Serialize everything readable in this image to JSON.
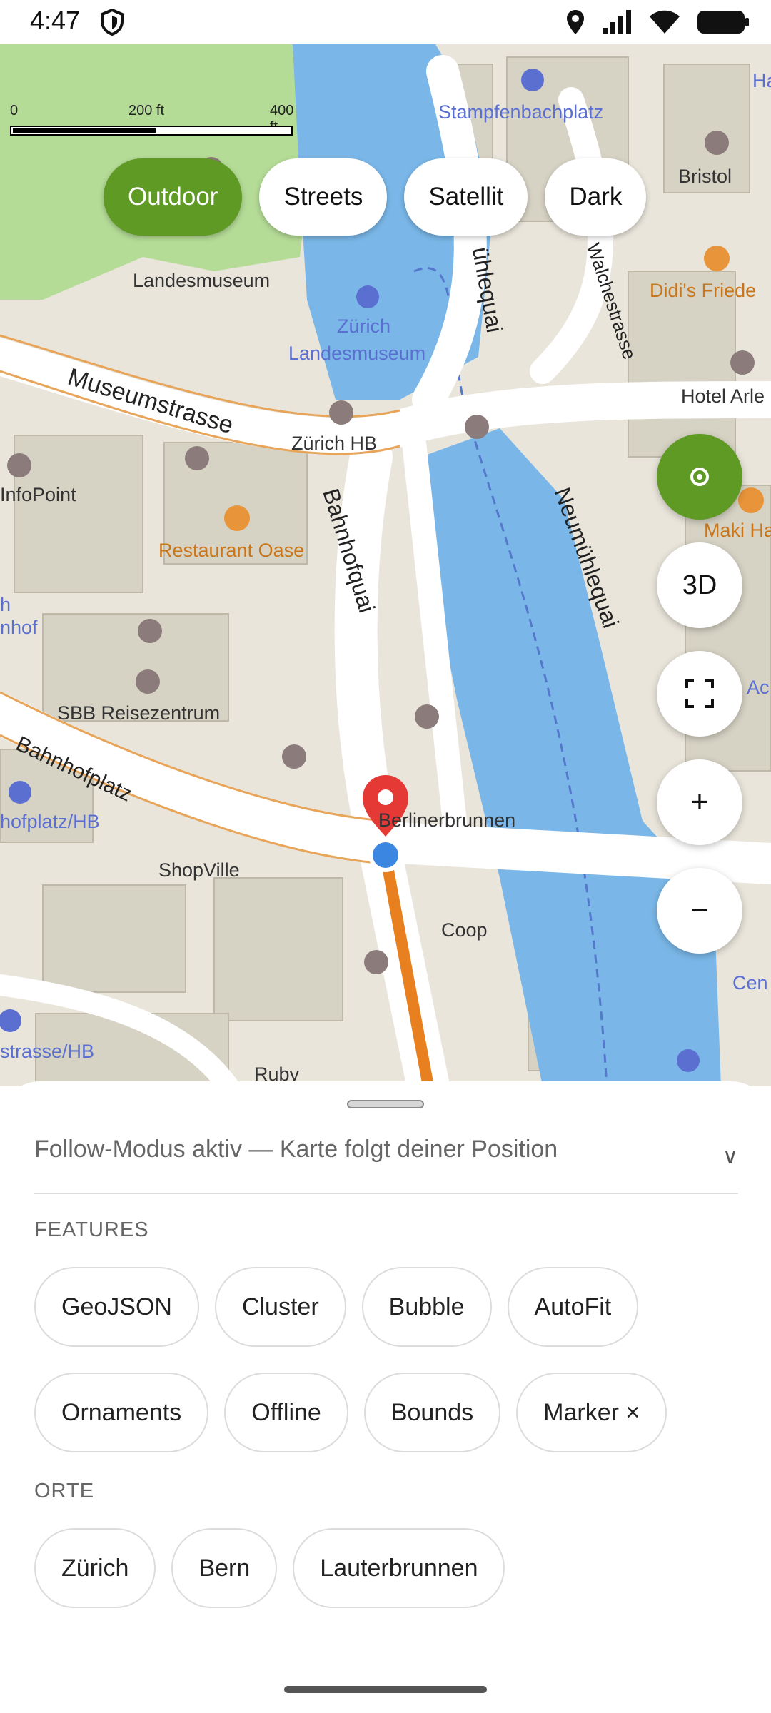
{
  "status_bar": {
    "time": "4:47"
  },
  "map": {
    "scale": {
      "labels": [
        "0",
        "200 ft",
        "400 ft"
      ]
    },
    "style_buttons": [
      {
        "label": "Outdoor",
        "active": true
      },
      {
        "label": "Streets",
        "active": false
      },
      {
        "label": "Satellit",
        "active": false
      },
      {
        "label": "Dark",
        "active": false
      }
    ],
    "labels": {
      "stampfenbachplatz": "Stampfenbachplatz",
      "bristol": "Bristol",
      "didis": "Didi's Friede",
      "hotel_arle": "Hotel Arle",
      "maki": "Maki Ha",
      "landesmuseum": "Landesmuseum",
      "zurich_landesmuseum_1": "Zürich",
      "zurich_landesmuseum_2": "Landesmuseum",
      "zurich_hb": "Zürich HB",
      "infopoint": "InfoPoint",
      "restaurant_oase": "Restaurant Oase",
      "nhof": "nhof",
      "n": "h",
      "sbb": "SBB Reisezentrum",
      "berlinerbrunnen": "Berlinerbrunnen",
      "hofplatz": "hofplatz/HB",
      "shopville": "ShopVille",
      "coop": "Coop",
      "strasse_hb": "strasse/HB",
      "ruby": "Ruby",
      "ac": "Ac",
      "cen": "Cen",
      "ha": "Ha"
    },
    "streets": {
      "museumstrasse": "Museumstrasse",
      "bahnhofquai": "Bahnhofquai",
      "neumuehlequai": "Neumühlequai",
      "muehlequai": "ühlequai",
      "walchestrasse": "Walchestrasse",
      "bahnhofplatz": "Bahnhofplatz"
    },
    "controls": {
      "three_d": "3D",
      "zoom_in": "+",
      "zoom_out": "−"
    }
  },
  "sheet": {
    "follow_text": "Follow-Modus aktiv — Karte folgt deiner Position",
    "features_title": "FEATURES",
    "features": [
      "GeoJSON",
      "Cluster",
      "Bubble",
      "AutoFit",
      "Ornaments",
      "Offline",
      "Bounds",
      "Marker ×"
    ],
    "places_title": "ORTE",
    "places": [
      "Zürich",
      "Bern",
      "Lauterbrunnen"
    ]
  },
  "colors": {
    "accent": "#5f9a25",
    "water": "#7ab7e8",
    "route": "#e8801f",
    "marker": "#e53935",
    "location": "#3b86e0"
  }
}
